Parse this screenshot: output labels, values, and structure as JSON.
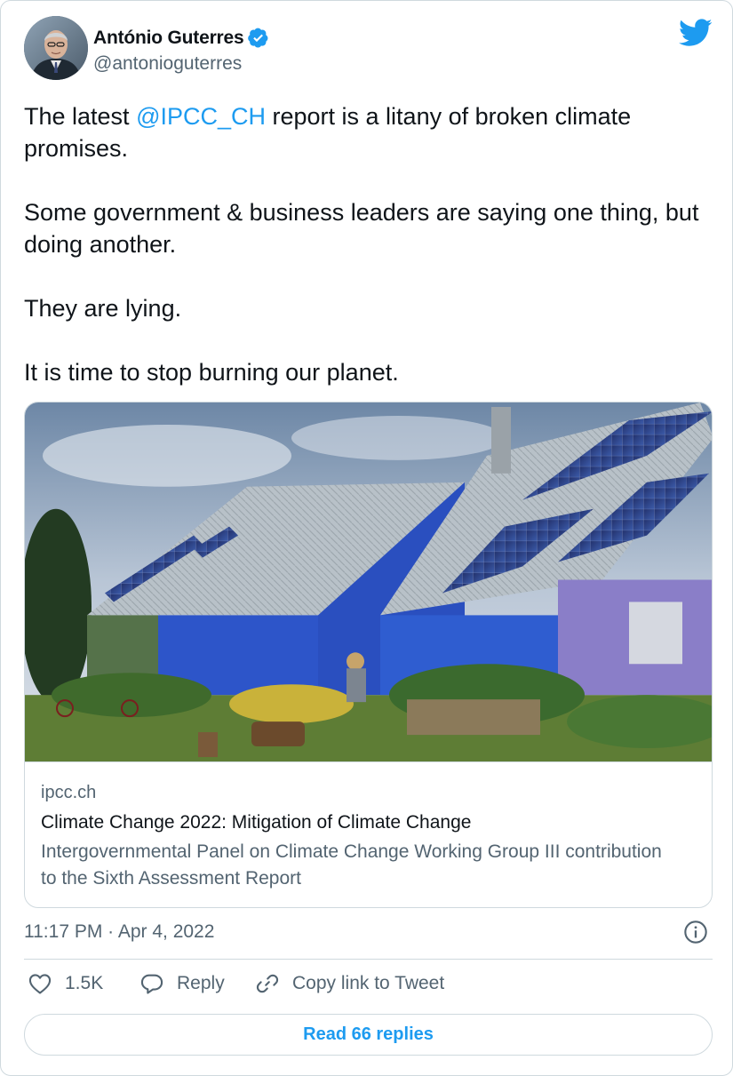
{
  "author": {
    "name": "António Guterres",
    "handle": "@antonioguterres"
  },
  "tweet": {
    "text": [
      {
        "before": "The latest ",
        "mention": "@IPCC_CH",
        "after": " report is a litany of broken climate promises."
      },
      {
        "text": "Some government & business leaders are saying one thing, but doing another."
      },
      {
        "text": "They are lying."
      },
      {
        "text": "It is time to stop burning our planet."
      }
    ],
    "timestamp": "11:17 PM · Apr 4, 2022"
  },
  "card": {
    "domain": "ipcc.ch",
    "title": "Climate Change 2022: Mitigation of Climate Change",
    "description": "Intergovernmental Panel on Climate Change Working Group III contribution to the Sixth Assessment Report"
  },
  "actions": {
    "like_count": "1.5K",
    "reply_label": "Reply",
    "copy_label": "Copy link to Tweet"
  },
  "read_replies_label": "Read 66 replies",
  "colors": {
    "accent": "#1d9bf0",
    "text": "#0f1419",
    "muted": "#536471",
    "border": "#cfd9de"
  },
  "icons": [
    "verified-badge-icon",
    "twitter-bird-icon",
    "info-icon",
    "heart-icon",
    "reply-icon",
    "link-icon"
  ]
}
